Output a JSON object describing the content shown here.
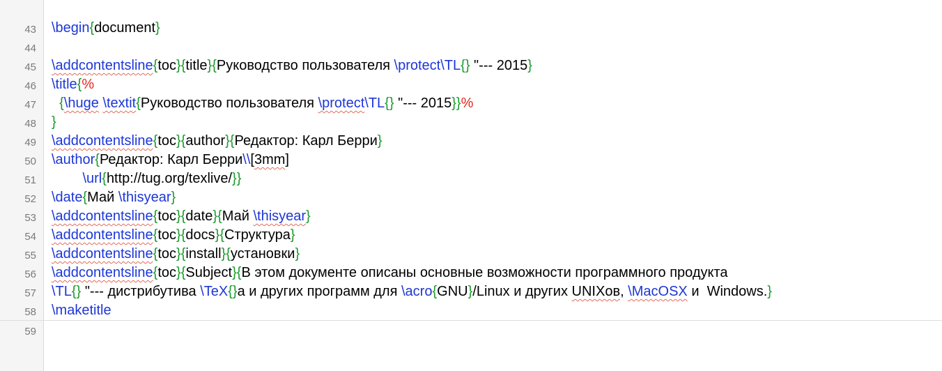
{
  "editor": {
    "lines": [
      {
        "n": "43",
        "t": [
          {
            "c": "cmd",
            "v": "\\begin"
          },
          {
            "c": "br",
            "v": "{"
          },
          {
            "v": "document"
          },
          {
            "c": "br",
            "v": "}"
          }
        ]
      },
      {
        "n": "44",
        "t": []
      },
      {
        "n": "45",
        "t": [
          {
            "c": "cmd sq",
            "v": "\\addcontentsline"
          },
          {
            "c": "br",
            "v": "{"
          },
          {
            "v": "toc"
          },
          {
            "c": "br",
            "v": "}{"
          },
          {
            "v": "title"
          },
          {
            "c": "br",
            "v": "}{"
          },
          {
            "v": "Руководство пользователя "
          },
          {
            "c": "cmd",
            "v": "\\protect\\TL"
          },
          {
            "c": "br",
            "v": "{}"
          },
          {
            "v": " \"--- 2015"
          },
          {
            "c": "br",
            "v": "}"
          }
        ]
      },
      {
        "n": "46",
        "t": [
          {
            "c": "cmd",
            "v": "\\title"
          },
          {
            "c": "br",
            "v": "{"
          },
          {
            "c": "pct",
            "v": "%"
          }
        ]
      },
      {
        "n": "47",
        "t": [
          {
            "v": "  "
          },
          {
            "c": "br",
            "v": "{"
          },
          {
            "c": "cmd sq",
            "v": "\\huge"
          },
          {
            "v": " "
          },
          {
            "c": "cmd sq",
            "v": "\\textit"
          },
          {
            "c": "br",
            "v": "{"
          },
          {
            "v": "Руководство пользователя "
          },
          {
            "c": "cmd sq",
            "v": "\\protect"
          },
          {
            "c": "cmd",
            "v": "\\TL"
          },
          {
            "c": "br",
            "v": "{}"
          },
          {
            "v": " \"--- 2015"
          },
          {
            "c": "br",
            "v": "}}"
          },
          {
            "c": "pct",
            "v": "%"
          }
        ]
      },
      {
        "n": "48",
        "t": [
          {
            "c": "br",
            "v": "}"
          }
        ]
      },
      {
        "n": "49",
        "t": [
          {
            "c": "cmd sq",
            "v": "\\addcontentsline"
          },
          {
            "c": "br",
            "v": "{"
          },
          {
            "v": "toc"
          },
          {
            "c": "br",
            "v": "}{"
          },
          {
            "v": "author"
          },
          {
            "c": "br",
            "v": "}{"
          },
          {
            "v": "Редактор: Карл Берри"
          },
          {
            "c": "br",
            "v": "}"
          }
        ]
      },
      {
        "n": "50",
        "t": [
          {
            "c": "cmd",
            "v": "\\author"
          },
          {
            "c": "br",
            "v": "{"
          },
          {
            "v": "Редактор: Карл Берри"
          },
          {
            "c": "cmd",
            "v": "\\\\"
          },
          {
            "v": "["
          },
          {
            "c": "sq",
            "v": "3mm"
          },
          {
            "v": "]"
          }
        ]
      },
      {
        "n": "51",
        "t": [
          {
            "v": "        "
          },
          {
            "c": "cmd",
            "v": "\\url"
          },
          {
            "c": "br",
            "v": "{"
          },
          {
            "v": "http://tug.org/texlive/"
          },
          {
            "c": "br",
            "v": "}}"
          }
        ]
      },
      {
        "n": "52",
        "t": [
          {
            "c": "cmd",
            "v": "\\date"
          },
          {
            "c": "br",
            "v": "{"
          },
          {
            "v": "Май "
          },
          {
            "c": "cmd",
            "v": "\\thisyear"
          },
          {
            "c": "br",
            "v": "}"
          }
        ]
      },
      {
        "n": "53",
        "t": [
          {
            "c": "cmd sq",
            "v": "\\addcontentsline"
          },
          {
            "c": "br",
            "v": "{"
          },
          {
            "v": "toc"
          },
          {
            "c": "br",
            "v": "}{"
          },
          {
            "v": "date"
          },
          {
            "c": "br",
            "v": "}{"
          },
          {
            "v": "Май "
          },
          {
            "c": "cmd sq",
            "v": "\\thisyear"
          },
          {
            "c": "br",
            "v": "}"
          }
        ]
      },
      {
        "n": "54",
        "t": [
          {
            "c": "cmd sq",
            "v": "\\addcontentsline"
          },
          {
            "c": "br",
            "v": "{"
          },
          {
            "v": "toc"
          },
          {
            "c": "br",
            "v": "}{"
          },
          {
            "v": "docs"
          },
          {
            "c": "br",
            "v": "}{"
          },
          {
            "v": "Структура"
          },
          {
            "c": "br",
            "v": "}"
          }
        ]
      },
      {
        "n": "55",
        "t": [
          {
            "c": "cmd sq",
            "v": "\\addcontentsline"
          },
          {
            "c": "br",
            "v": "{"
          },
          {
            "v": "toc"
          },
          {
            "c": "br",
            "v": "}{"
          },
          {
            "v": "install"
          },
          {
            "c": "br",
            "v": "}{"
          },
          {
            "v": "установки"
          },
          {
            "c": "br",
            "v": "}"
          }
        ]
      },
      {
        "n": "56",
        "t": [
          {
            "c": "cmd sq",
            "v": "\\addcontentsline"
          },
          {
            "c": "br",
            "v": "{"
          },
          {
            "v": "toc"
          },
          {
            "c": "br",
            "v": "}{"
          },
          {
            "v": "Subject"
          },
          {
            "c": "br",
            "v": "}{"
          },
          {
            "v": "В этом документе описаны основные возможности программного продукта"
          }
        ]
      },
      {
        "n": "57",
        "t": [
          {
            "c": "cmd",
            "v": "\\TL"
          },
          {
            "c": "br",
            "v": "{}"
          },
          {
            "v": " \"--- дистрибутива "
          },
          {
            "c": "cmd",
            "v": "\\TeX"
          },
          {
            "c": "br",
            "v": "{}"
          },
          {
            "v": "а и других программ для "
          },
          {
            "c": "cmd",
            "v": "\\acro"
          },
          {
            "c": "br",
            "v": "{"
          },
          {
            "v": "GNU"
          },
          {
            "c": "br",
            "v": "}"
          },
          {
            "v": "/Linux и других "
          },
          {
            "c": "sq",
            "v": "UNIXов"
          },
          {
            "v": ", "
          },
          {
            "c": "cmd sq",
            "v": "\\MacOSX"
          },
          {
            "v": " и  Windows."
          },
          {
            "c": "br",
            "v": "}"
          }
        ]
      },
      {
        "n": "58",
        "t": [
          {
            "c": "cmd",
            "v": "\\maketitle"
          }
        ]
      },
      {
        "n": "59",
        "t": []
      }
    ]
  }
}
